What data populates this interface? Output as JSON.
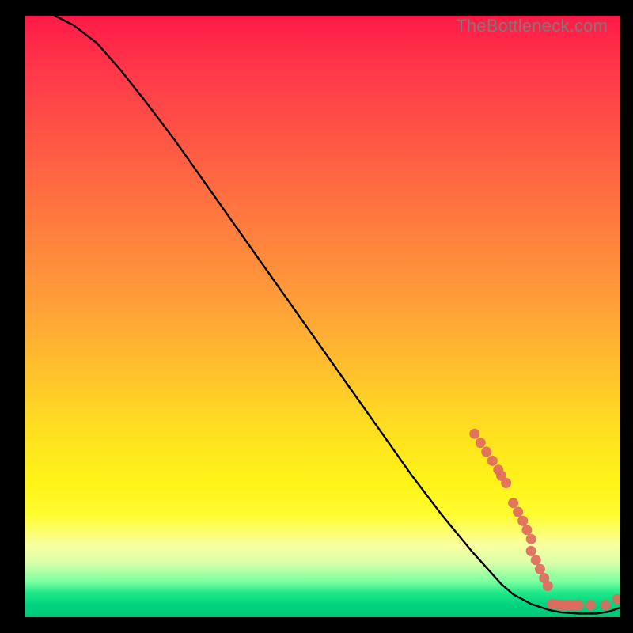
{
  "watermark": "TheBottleneck.com",
  "chart_data": {
    "type": "line",
    "title": "",
    "xlabel": "",
    "ylabel": "",
    "xlim": [
      0,
      100
    ],
    "ylim": [
      0,
      100
    ],
    "grid": false,
    "series": [
      {
        "name": "curve",
        "x": [
          5,
          8,
          12,
          16,
          20,
          25,
          30,
          35,
          40,
          45,
          50,
          55,
          60,
          65,
          70,
          75,
          80,
          82,
          85,
          88,
          90,
          93,
          96,
          98,
          100
        ],
        "y": [
          100,
          98.5,
          95.5,
          91,
          86,
          79.5,
          72.5,
          65.5,
          58.5,
          51.5,
          44.5,
          37.5,
          30.5,
          23.5,
          17,
          11,
          5.5,
          3.8,
          2.2,
          1.2,
          0.8,
          0.6,
          0.6,
          0.9,
          1.6
        ]
      }
    ],
    "markers": [
      {
        "x": 75.5,
        "y": 30.5
      },
      {
        "x": 76.5,
        "y": 29.0
      },
      {
        "x": 77.5,
        "y": 27.5
      },
      {
        "x": 78.5,
        "y": 26.0
      },
      {
        "x": 79.5,
        "y": 24.5
      },
      {
        "x": 80.0,
        "y": 23.5
      },
      {
        "x": 80.8,
        "y": 22.3
      },
      {
        "x": 82.0,
        "y": 19.0
      },
      {
        "x": 82.8,
        "y": 17.5
      },
      {
        "x": 83.6,
        "y": 16.0
      },
      {
        "x": 84.3,
        "y": 14.5
      },
      {
        "x": 85.0,
        "y": 13.0
      },
      {
        "x": 85.0,
        "y": 11.0
      },
      {
        "x": 85.8,
        "y": 9.5
      },
      {
        "x": 86.5,
        "y": 8.0
      },
      {
        "x": 87.2,
        "y": 6.5
      },
      {
        "x": 87.8,
        "y": 5.2
      },
      {
        "x": 88.5,
        "y": 2.2
      },
      {
        "x": 89.2,
        "y": 2.1
      },
      {
        "x": 90.0,
        "y": 2.0
      },
      {
        "x": 90.8,
        "y": 2.0
      },
      {
        "x": 91.5,
        "y": 2.0
      },
      {
        "x": 92.3,
        "y": 2.0
      },
      {
        "x": 93.0,
        "y": 2.0
      },
      {
        "x": 95.0,
        "y": 2.0
      },
      {
        "x": 97.5,
        "y": 2.0
      },
      {
        "x": 99.5,
        "y": 3.0
      }
    ],
    "marker_color": "#e06a5e",
    "line_color": "#000000"
  }
}
